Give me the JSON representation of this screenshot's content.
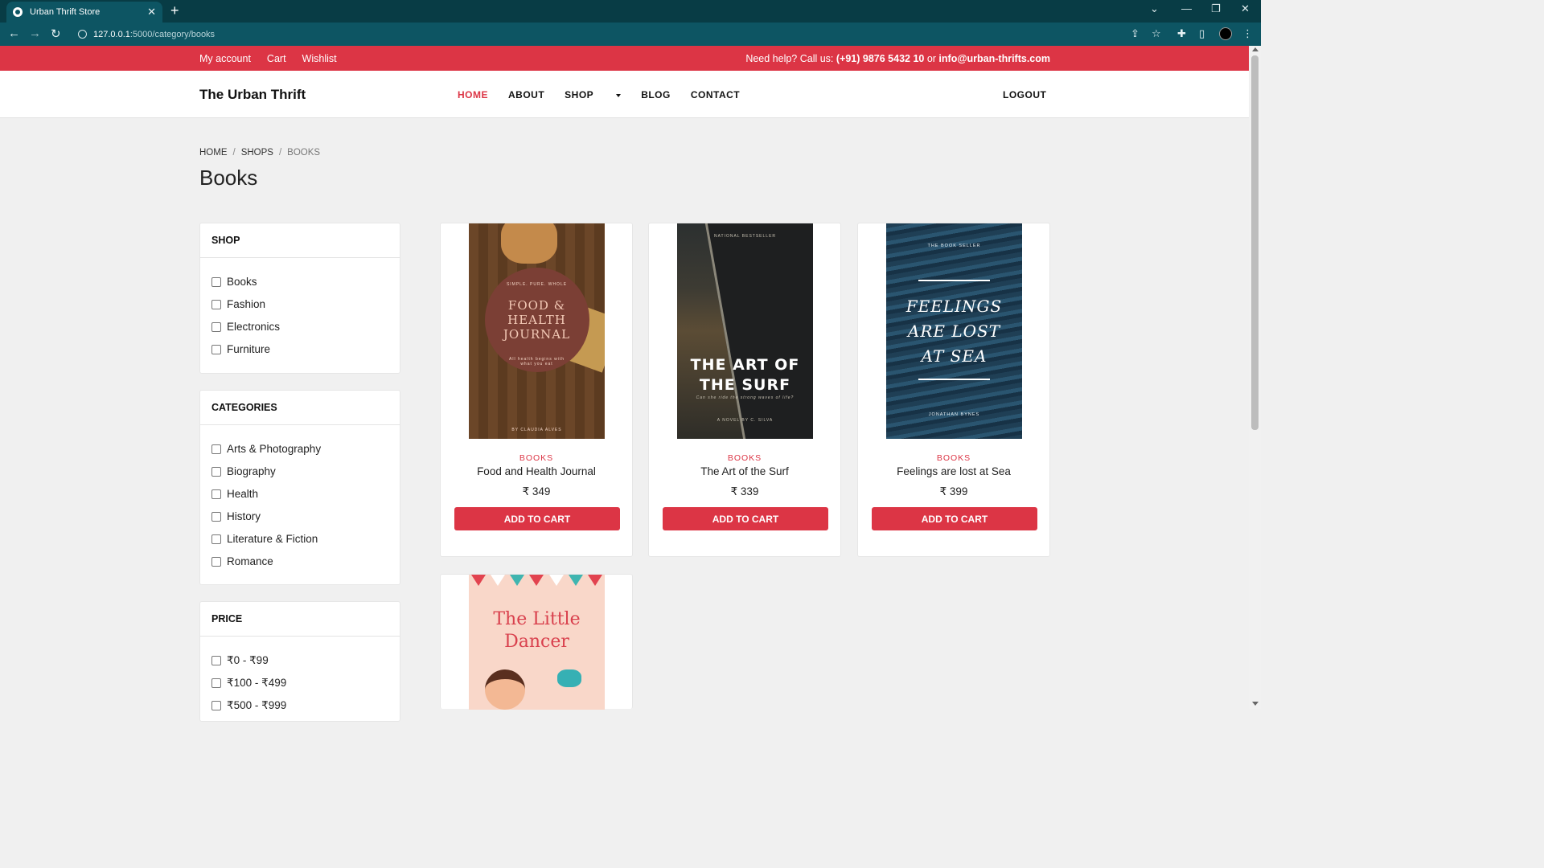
{
  "browser": {
    "tab_title": "Urban Thrift Store",
    "tab_close": "✕",
    "new_tab": "+",
    "url_host": "127.0.0.1",
    "url_path": ":5000/category/books",
    "icons": [
      "back-icon",
      "forward-icon",
      "reload-icon",
      "info-icon",
      "share-icon",
      "star-icon",
      "extensions-icon",
      "sidepanel-icon",
      "menu-icon"
    ]
  },
  "topbar": {
    "links": [
      "My account",
      "Cart",
      "Wishlist"
    ],
    "help_prefix": "Need help? Call us: ",
    "phone": "(+91) 9876 5432 10",
    "or": " or ",
    "email": "info@urban-thrifts.com"
  },
  "header": {
    "brand": "The Urban Thrift",
    "menu": [
      "HOME",
      "ABOUT",
      "SHOP",
      "BLOG",
      "CONTACT"
    ],
    "logout": "LOGOUT"
  },
  "breadcrumb": [
    "HOME",
    "SHOPS",
    "BOOKS"
  ],
  "page_title": "Books",
  "filters": {
    "shop": {
      "title": "SHOP",
      "options": [
        "Books",
        "Fashion",
        "Electronics",
        "Furniture"
      ]
    },
    "categories": {
      "title": "CATEGORIES",
      "options": [
        "Arts & Photography",
        "Biography",
        "Health",
        "History",
        "Literature & Fiction",
        "Romance"
      ]
    },
    "price": {
      "title": "PRICE",
      "options": [
        "₹0 - ₹99",
        "₹100 - ₹499",
        "₹500 - ₹999"
      ]
    }
  },
  "products": [
    {
      "category": "BOOKS",
      "name": "Food and Health Journal",
      "price": "₹ 349",
      "button": "ADD TO CART",
      "cover": {
        "lines": [
          "FOOD &",
          "HEALTH",
          "JOURNAL"
        ],
        "top": "SIMPLE. PURE. WHOLE",
        "sub": "All health begins with what you eat",
        "author": "BY CLAUDIA ALVES"
      }
    },
    {
      "category": "BOOKS",
      "name": "The Art of the Surf",
      "price": "₹ 339",
      "button": "ADD TO CART",
      "cover": {
        "lines": [
          "THE ART OF",
          "THE SURF"
        ],
        "top": "NATIONAL BESTSELLER",
        "sub": "Can she ride the strong waves of life?",
        "author": "A NOVEL BY C. SILVA"
      }
    },
    {
      "category": "BOOKS",
      "name": "Feelings are lost at Sea",
      "price": "₹ 399",
      "button": "ADD TO CART",
      "cover": {
        "lines": [
          "FEELINGS",
          "ARE LOST",
          "AT SEA"
        ],
        "top": "THE BOOK SELLER",
        "author": "JONATHAN BYNES"
      }
    },
    {
      "cover": {
        "lines": [
          "The Little",
          "Dancer"
        ]
      }
    }
  ]
}
